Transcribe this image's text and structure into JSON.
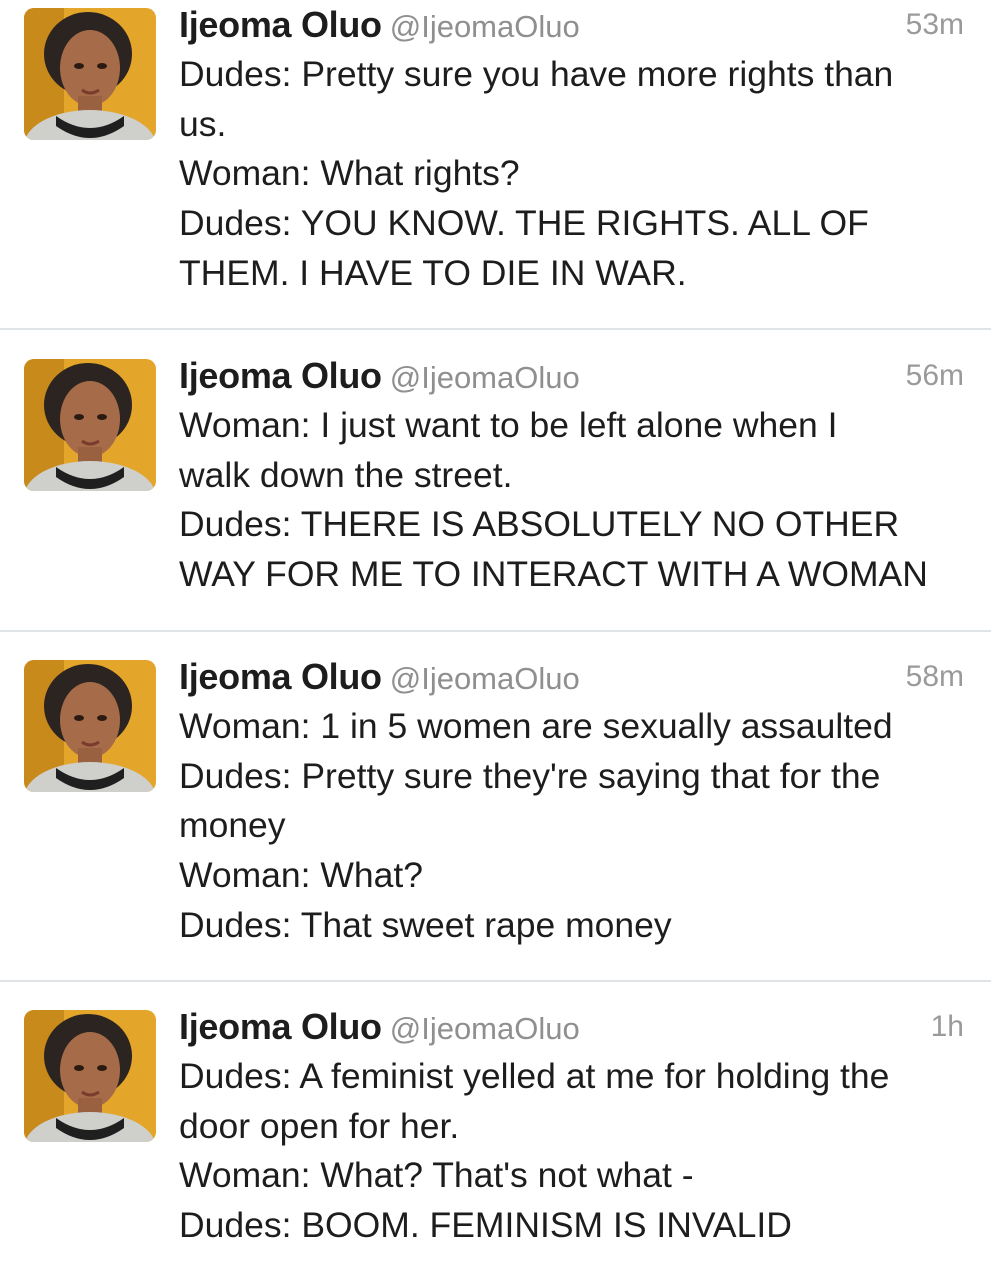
{
  "tweets": [
    {
      "name": "Ijeoma Oluo",
      "handle": "@IjeomaOluo",
      "time": "53m",
      "lines": [
        "Dudes: Pretty sure you have more rights than",
        "us.",
        "Woman: What rights?",
        "Dudes: YOU KNOW. THE RIGHTS. ALL OF",
        "THEM. I HAVE TO DIE IN WAR."
      ]
    },
    {
      "name": "Ijeoma Oluo",
      "handle": "@IjeomaOluo",
      "time": "56m",
      "lines": [
        "Woman: I just want to be left alone when I",
        "walk down the street.",
        "Dudes: THERE IS ABSOLUTELY NO OTHER",
        "WAY FOR ME TO INTERACT WITH A WOMAN"
      ]
    },
    {
      "name": "Ijeoma Oluo",
      "handle": "@IjeomaOluo",
      "time": "58m",
      "lines": [
        "Woman: 1 in 5 women are sexually assaulted",
        "Dudes: Pretty sure they're saying that for the",
        "money",
        "Woman: What?",
        "Dudes: That sweet rape money"
      ]
    },
    {
      "name": "Ijeoma Oluo",
      "handle": "@IjeomaOluo",
      "time": "1h",
      "lines": [
        "Dudes: A feminist yelled at me for holding the",
        "door open for her.",
        "Woman: What? That's not what -",
        "Dudes: BOOM. FEMINISM IS INVALID"
      ]
    }
  ]
}
